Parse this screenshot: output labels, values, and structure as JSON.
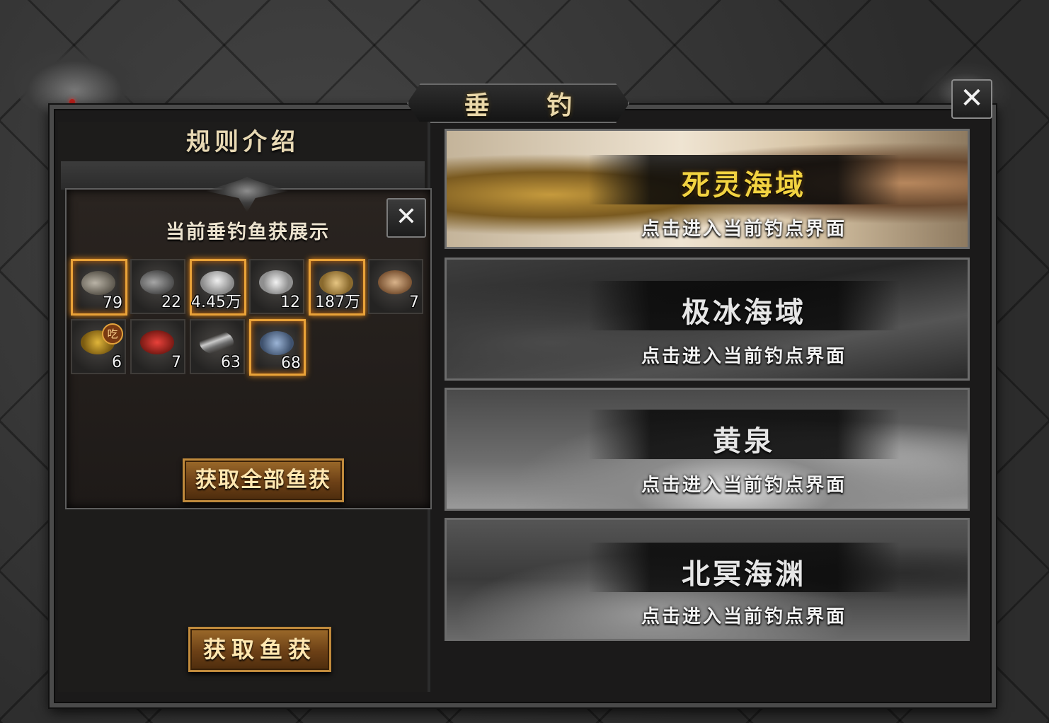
{
  "window": {
    "title": "垂 钓",
    "close_icon": "close-icon"
  },
  "left": {
    "rules_title": "规则介绍",
    "catch_popup": {
      "title": "当前垂钓鱼获展示",
      "items": [
        {
          "icon": "fish-icon",
          "count": "79",
          "highlight": true
        },
        {
          "icon": "shark-icon",
          "count": "22",
          "highlight": false
        },
        {
          "icon": "silver-ingot-icon",
          "count": "4.45万",
          "highlight": true
        },
        {
          "icon": "pearl-shell-icon",
          "count": "12",
          "highlight": false
        },
        {
          "icon": "gold-coins-icon",
          "count": "187万",
          "highlight": true
        },
        {
          "icon": "carp-icon",
          "count": "7",
          "highlight": false
        },
        {
          "icon": "gold-medal-icon",
          "count": "6",
          "highlight": false,
          "badge": "吃"
        },
        {
          "icon": "red-fish-icon",
          "count": "7",
          "highlight": false
        },
        {
          "icon": "eel-icon",
          "count": "63",
          "highlight": false
        },
        {
          "icon": "blue-ore-icon",
          "count": "68",
          "highlight": true
        }
      ],
      "claim_all_label": "获取全部鱼获"
    },
    "claim_label": "获取鱼获"
  },
  "zones": [
    {
      "name": "死灵海域",
      "hint": "点击进入当前钓点界面",
      "name_color": "#f2d341"
    },
    {
      "name": "极冰海域",
      "hint": "点击进入当前钓点界面",
      "name_color": "#e6e6e6"
    },
    {
      "name": "黄泉",
      "hint": "点击进入当前钓点界面",
      "name_color": "#e6e6e6"
    },
    {
      "name": "北冥海渊",
      "hint": "点击进入当前钓点界面",
      "name_color": "#e6e6e6"
    }
  ]
}
